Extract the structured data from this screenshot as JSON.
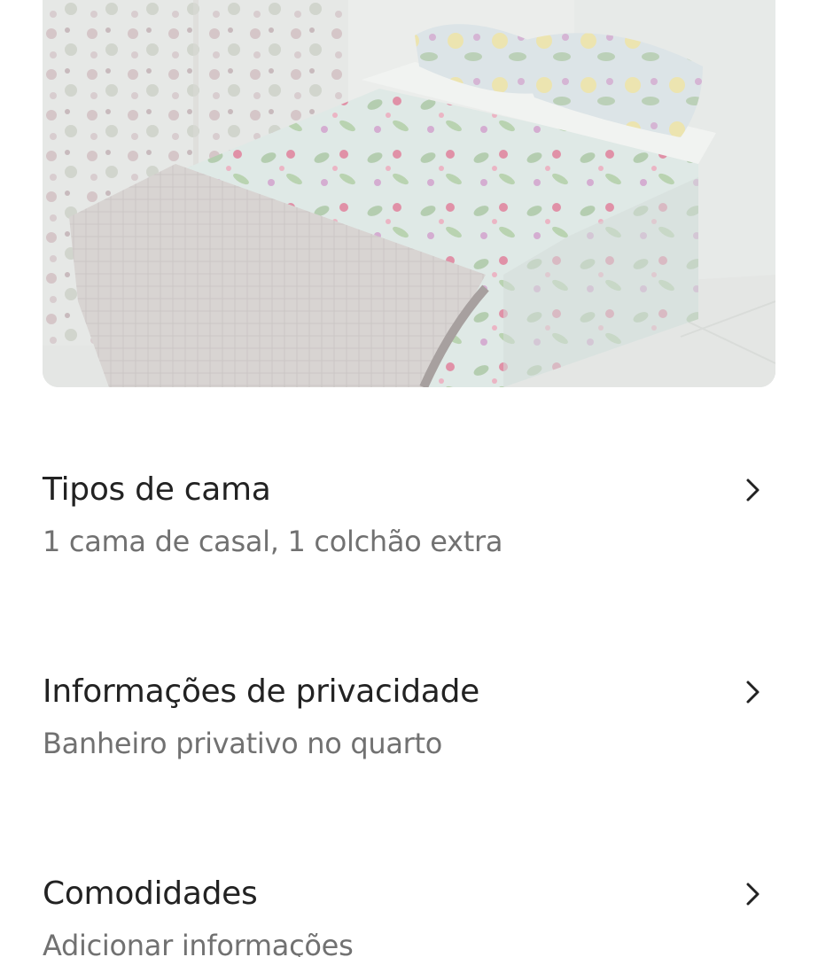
{
  "photo": {
    "alt_icon": "room-photo"
  },
  "rows": [
    {
      "title": "Tipos de cama",
      "subtitle": "1 cama de casal, 1 colchão extra",
      "icon": "chevron-right-icon"
    },
    {
      "title": "Informações de privacidade",
      "subtitle": "Banheiro privativo no quarto",
      "icon": "chevron-right-icon"
    },
    {
      "title": "Comodidades",
      "subtitle": "Adicionar informações",
      "icon": "chevron-right-icon"
    }
  ],
  "colors": {
    "title": "#222222",
    "subtitle": "#717171",
    "background": "#ffffff"
  }
}
